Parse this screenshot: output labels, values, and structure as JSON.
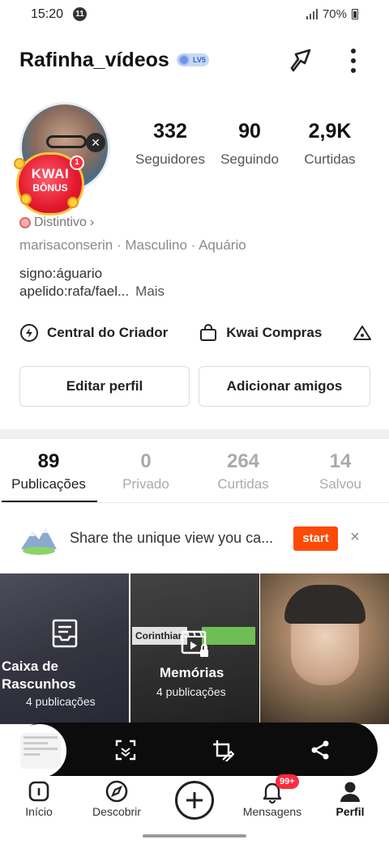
{
  "status_bar": {
    "time": "15:20",
    "notification_count": "11",
    "battery": "70%",
    "icons": [
      "signal-icon",
      "battery-icon"
    ]
  },
  "header": {
    "username": "Rafinha_vídeos",
    "level": "LV5",
    "icons": [
      "share-icon",
      "more-icon"
    ]
  },
  "profile": {
    "kwai_badge_line1": "KWAI",
    "kwai_badge_line2": "BÔNUS",
    "kwai_badge_notification": "1",
    "stats": [
      {
        "value": "332",
        "label": "Seguidores"
      },
      {
        "value": "90",
        "label": "Seguindo"
      },
      {
        "value": "2,9K",
        "label": "Curtidas"
      }
    ],
    "distintivo": "Distintivo",
    "distintivo_chevron": "›",
    "meta": "marisaconserin · Masculino · Aquário",
    "bio_line1": "signo:águario",
    "bio_line2": "apelido:rafa/fael...",
    "bio_more": "Mais"
  },
  "quick_links": [
    {
      "label": "Central do Criador",
      "icon": "lightning-icon"
    },
    {
      "label": "Kwai Compras",
      "icon": "shopping-bag-icon"
    },
    {
      "label": "",
      "icon": "tent-icon"
    }
  ],
  "buttons": {
    "edit_profile": "Editar perfil",
    "add_friends": "Adicionar amigos"
  },
  "tabs": [
    {
      "count": "89",
      "label": "Publicações",
      "active": true
    },
    {
      "count": "0",
      "label": "Privado",
      "active": false
    },
    {
      "count": "264",
      "label": "Curtidas",
      "active": false
    },
    {
      "count": "14",
      "label": "Salvou",
      "active": false
    }
  ],
  "promo": {
    "text": "Share the unique view you ca...",
    "button": "start",
    "close": "×"
  },
  "grid": [
    {
      "title_line1": "Caixa de",
      "title_line2": "Rascunhos",
      "subtitle": "4 publicações",
      "icon": "inbox-icon"
    },
    {
      "title": "Memórias",
      "subtitle": "4 publicações",
      "icon": "memories-lock-icon",
      "sticker": "Corinthian"
    },
    {
      "title": "",
      "subtitle": ""
    }
  ],
  "floating_toolbar": {
    "icons": [
      "scan-icon",
      "edit-crop-icon",
      "share-nodes-icon"
    ]
  },
  "bottom_nav": [
    {
      "label": "Início",
      "icon": "home-icon"
    },
    {
      "label": "Descobrir",
      "icon": "compass-icon"
    },
    {
      "label": "",
      "icon": "plus-icon"
    },
    {
      "label": "Mensagens",
      "icon": "bell-icon",
      "badge": "99+"
    },
    {
      "label": "Perfil",
      "icon": "person-icon",
      "active": true
    }
  ],
  "colors": {
    "accent": "#ff4906",
    "badge_red": "#ff2a3e",
    "text_primary": "#111111",
    "text_muted": "#8a8a8a"
  }
}
